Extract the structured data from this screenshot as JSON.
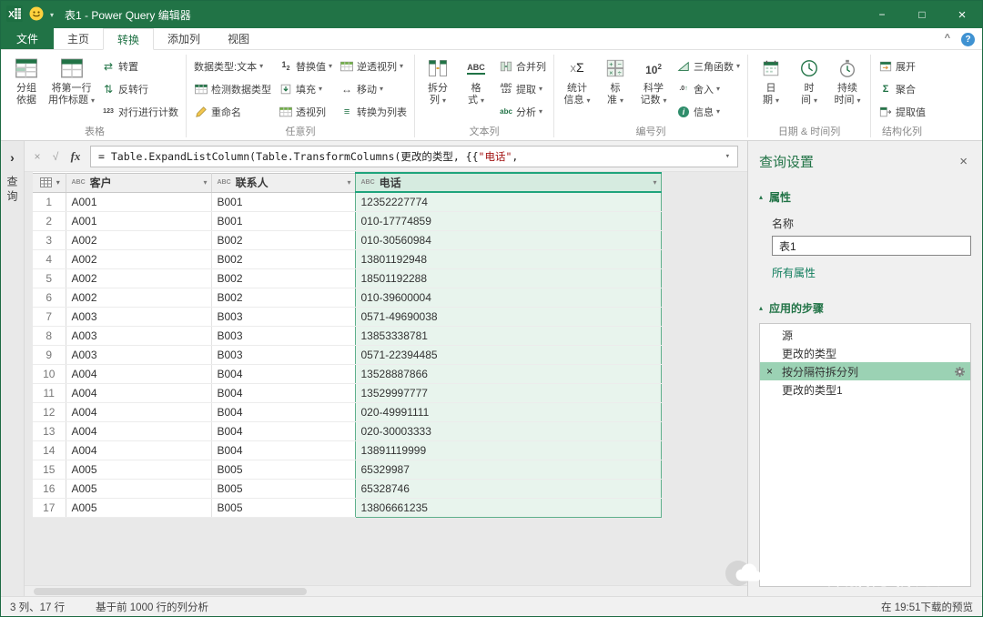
{
  "colors": {
    "accent": "#217346",
    "string_literal": "#a31515",
    "step_selection": "#9bd2b4",
    "column_highlight": "#e8f4ed"
  },
  "titlebar": {
    "title": "表1 - Power Query 编辑器"
  },
  "ribbon": {
    "file_tab": "文件",
    "tabs": [
      {
        "label": "主页",
        "active": false
      },
      {
        "label": "转换",
        "active": true
      },
      {
        "label": "添加列",
        "active": false
      },
      {
        "label": "视图",
        "active": false
      }
    ],
    "groups": [
      {
        "label": "表格",
        "columns": [
          {
            "type": "large",
            "item": {
              "label": "分组依据",
              "lines": [
                "分组",
                "依据"
              ],
              "icon": "group-by",
              "dd": false
            }
          },
          {
            "type": "large",
            "item": {
              "label": "将第一行用作标题",
              "lines": [
                "将第一行",
                "用作标题"
              ],
              "icon": "first-row-headers",
              "dd": true
            }
          },
          {
            "type": "stack",
            "items": [
              {
                "label": "转置",
                "icon": "transpose",
                "dd": false
              },
              {
                "label": "反转行",
                "icon": "reverse-rows",
                "dd": false
              },
              {
                "label": "对行进行计数",
                "icon": "count-rows",
                "dd": false
              }
            ]
          }
        ]
      },
      {
        "label": "任意列",
        "columns": [
          {
            "type": "stack",
            "items": [
              {
                "label": "数据类型:文本",
                "icon": null,
                "dd": true
              },
              {
                "label": "检测数据类型",
                "icon": "detect-data-type",
                "dd": false
              },
              {
                "label": "重命名",
                "icon": "rename",
                "dd": false
              }
            ]
          },
          {
            "type": "stack",
            "items": [
              {
                "label": "替换值",
                "icon": "replace-values",
                "dd": true
              },
              {
                "label": "填充",
                "icon": "fill",
                "dd": true
              },
              {
                "label": "透视列",
                "icon": "pivot-column",
                "dd": false
              }
            ]
          },
          {
            "type": "stack",
            "items": [
              {
                "label": "逆透视列",
                "icon": "unpivot-columns",
                "dd": true
              },
              {
                "label": "移动",
                "icon": "move",
                "dd": true
              },
              {
                "label": "转换为列表",
                "icon": "convert-to-list",
                "dd": false
              }
            ]
          }
        ]
      },
      {
        "label": "文本列",
        "columns": [
          {
            "type": "large",
            "item": {
              "label": "拆分列",
              "lines": [
                "拆分",
                "列"
              ],
              "icon": "split-column",
              "dd": true
            }
          },
          {
            "type": "large",
            "item": {
              "label": "格式",
              "lines": [
                "格",
                "式"
              ],
              "icon": "format",
              "dd": true
            }
          },
          {
            "type": "stack",
            "items": [
              {
                "label": "合并列",
                "icon": "merge-columns",
                "dd": false
              },
              {
                "label": "提取",
                "icon": "extract",
                "dd": true
              },
              {
                "label": "分析",
                "icon": "parse",
                "dd": true
              }
            ]
          }
        ]
      },
      {
        "label": "编号列",
        "columns": [
          {
            "type": "large",
            "item": {
              "label": "统计信息",
              "lines": [
                "统计",
                "信息"
              ],
              "icon": "statistics",
              "dd": true
            }
          },
          {
            "type": "large",
            "item": {
              "label": "标准",
              "lines": [
                "标",
                "准"
              ],
              "icon": "standard",
              "dd": true
            }
          },
          {
            "type": "large",
            "item": {
              "label": "科学记数",
              "lines": [
                "科学",
                "记数"
              ],
              "icon": "scientific",
              "dd": true
            }
          },
          {
            "type": "stack",
            "items": [
              {
                "label": "三角函数",
                "icon": "trigonometry",
                "dd": true
              },
              {
                "label": "舍入",
                "icon": "rounding",
                "dd": true
              },
              {
                "label": "信息",
                "icon": "information",
                "dd": true
              }
            ]
          }
        ]
      },
      {
        "label": "日期 & 时间列",
        "columns": [
          {
            "type": "large",
            "item": {
              "label": "日期",
              "lines": [
                "日",
                "期"
              ],
              "icon": "date",
              "dd": true
            }
          },
          {
            "type": "large",
            "item": {
              "label": "时间",
              "lines": [
                "时",
                "间"
              ],
              "icon": "time",
              "dd": true
            }
          },
          {
            "type": "large",
            "item": {
              "label": "持续时间",
              "lines": [
                "持续",
                "时间"
              ],
              "icon": "duration",
              "dd": true
            }
          }
        ]
      },
      {
        "label": "结构化列",
        "columns": [
          {
            "type": "stack",
            "items": [
              {
                "label": "展开",
                "icon": "expand",
                "dd": false
              },
              {
                "label": "聚合",
                "icon": "aggregate",
                "dd": false
              },
              {
                "label": "提取值",
                "icon": "extract-values",
                "dd": false
              }
            ]
          }
        ]
      }
    ]
  },
  "formula_bar": {
    "fx": "fx",
    "parts": [
      {
        "text": "= Table.ExpandListColumn(Table.TransformColumns(更改的类型, {{",
        "color": "default"
      },
      {
        "text": "\"电话\"",
        "color": "string"
      },
      {
        "text": ",",
        "color": "default"
      }
    ]
  },
  "left_pane": {
    "label": "查询"
  },
  "grid": {
    "columns": [
      {
        "name": "客户",
        "type": "ABC",
        "selected": false
      },
      {
        "name": "联系人",
        "type": "ABC",
        "selected": false
      },
      {
        "name": "电话",
        "type": "ABC",
        "selected": true
      }
    ],
    "rows": [
      [
        "A001",
        "B001",
        "12352227774"
      ],
      [
        "A001",
        "B001",
        "010-17774859"
      ],
      [
        "A002",
        "B002",
        "010-30560984"
      ],
      [
        "A002",
        "B002",
        "13801192948"
      ],
      [
        "A002",
        "B002",
        "18501192288"
      ],
      [
        "A002",
        "B002",
        "010-39600004"
      ],
      [
        "A003",
        "B003",
        "0571-49690038"
      ],
      [
        "A003",
        "B003",
        "13853338781"
      ],
      [
        "A003",
        "B003",
        "0571-22394485"
      ],
      [
        "A004",
        "B004",
        "13528887866"
      ],
      [
        "A004",
        "B004",
        "13529997777"
      ],
      [
        "A004",
        "B004",
        "020-49991111"
      ],
      [
        "A004",
        "B004",
        "020-30003333"
      ],
      [
        "A004",
        "B004",
        "13891119999"
      ],
      [
        "A005",
        "B005",
        "65329987"
      ],
      [
        "A005",
        "B005",
        "65328746"
      ],
      [
        "A005",
        "B005",
        "13806661235"
      ]
    ]
  },
  "query_settings": {
    "title": "查询设置",
    "sections": {
      "properties": "属性",
      "steps": "应用的步骤"
    },
    "name_label": "名称",
    "name_value": "表1",
    "all_properties_link": "所有属性",
    "steps": [
      {
        "label": "源",
        "selected": false,
        "gear": false
      },
      {
        "label": "更改的类型",
        "selected": false,
        "gear": false
      },
      {
        "label": "按分隔符拆分列",
        "selected": true,
        "gear": true
      },
      {
        "label": "更改的类型1",
        "selected": false,
        "gear": false
      }
    ]
  },
  "status_bar": {
    "columns_rows": "3 列、17 行",
    "profile": "基于前 1000 行的列分析",
    "preview": "在 19:51下载的预览"
  },
  "watermark": {
    "text": "Excel数据分析之道"
  }
}
